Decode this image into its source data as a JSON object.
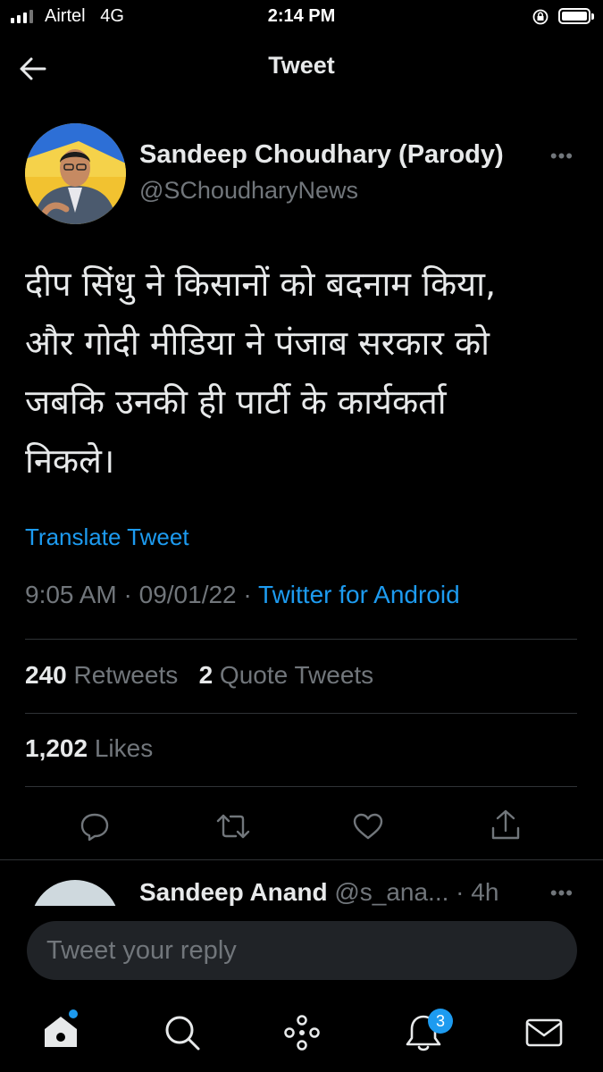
{
  "status_bar": {
    "carrier": "Airtel",
    "network": "4G",
    "time": "2:14 PM"
  },
  "header": {
    "title": "Tweet"
  },
  "tweet": {
    "author_name": "Sandeep Choudhary (Parody)",
    "author_handle": "@SChoudharyNews",
    "text": "दीप सिंधु ने किसानों को बदनाम किया,\nऔर गोदी मीडिया ने पंजाब सरकार को\nजबकि उनकी ही पार्टी के कार्यकर्ता\nनिकले।",
    "translate_label": "Translate Tweet",
    "time": "9:05 AM",
    "date": "09/01/22",
    "source": "Twitter for Android",
    "separator": "·",
    "retweets_count": "240",
    "retweets_label": "Retweets",
    "quotes_count": "2",
    "quotes_label": "Quote Tweets",
    "likes_count": "1,202",
    "likes_label": "Likes"
  },
  "reply_preview": {
    "name": "Sandeep Anand",
    "handle": "@s_ana...",
    "age": "· 4h"
  },
  "composer": {
    "placeholder": "Tweet your reply"
  },
  "tab_bar": {
    "notifications_badge": "3"
  },
  "colors": {
    "accent": "#1d9bf0",
    "background": "#000000",
    "muted": "#71767b"
  }
}
